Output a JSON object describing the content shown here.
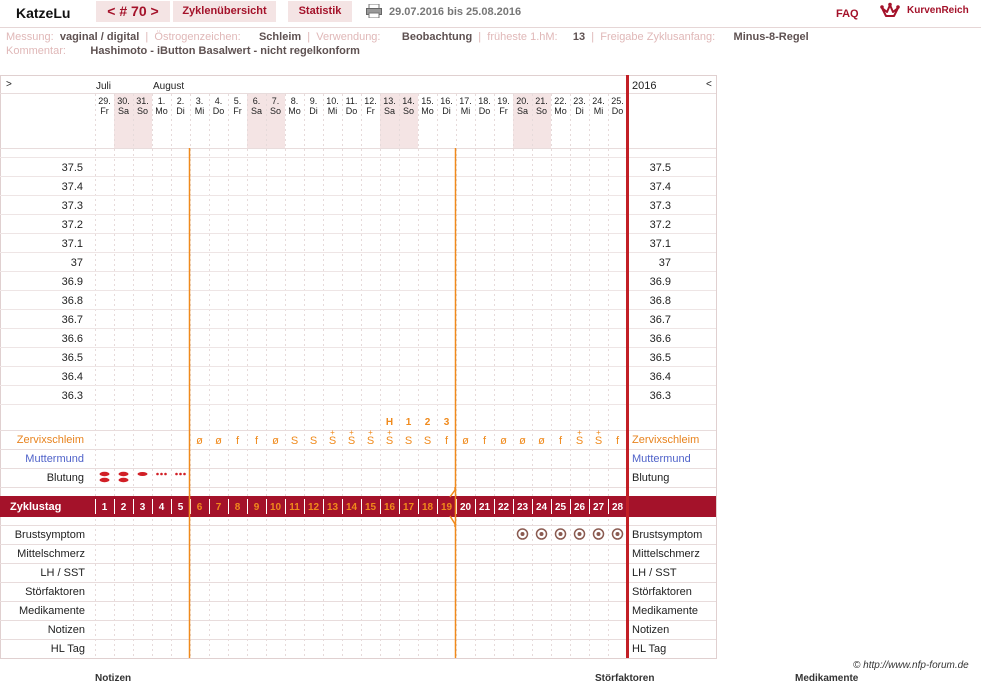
{
  "header": {
    "username": "KatzeLu",
    "cycle_nav": "< # 70 >",
    "tab_overview": "Zyklenübersicht",
    "tab_stats": "Statistik",
    "date_range": "29.07.2016 bis 25.08.2016",
    "faq": "FAQ",
    "brand": "KurvenReich"
  },
  "info": {
    "messung_label": "Messung:",
    "messung_value": "vaginal / digital",
    "oestrogen_label": "Östrogenzeichen:",
    "oestrogen_value": "Schleim",
    "verwendung_label": "Verwendung:",
    "verwendung_value": "Beobachtung",
    "fruehest_label": "früheste 1.hM:",
    "fruehest_value": "13",
    "freigabe_label": "Freigabe Zyklusanfang:",
    "freigabe_value": "Minus-8-Regel",
    "kommentar_label": "Kommentar:",
    "kommentar_value": "Hashimoto - iButton Basalwert - nicht regelkonform"
  },
  "chart": {
    "nav_left": ">",
    "nav_right": "<",
    "year": "2016",
    "months": [
      {
        "label": "Juli",
        "day_index": 0
      },
      {
        "label": "August",
        "day_index": 3
      }
    ],
    "days": [
      {
        "date": "29.",
        "wd": "Fr",
        "weekend": false
      },
      {
        "date": "30.",
        "wd": "Sa",
        "weekend": true
      },
      {
        "date": "31.",
        "wd": "So",
        "weekend": true
      },
      {
        "date": "1.",
        "wd": "Mo",
        "weekend": false
      },
      {
        "date": "2.",
        "wd": "Di",
        "weekend": false
      },
      {
        "date": "3.",
        "wd": "Mi",
        "weekend": false
      },
      {
        "date": "4.",
        "wd": "Do",
        "weekend": false
      },
      {
        "date": "5.",
        "wd": "Fr",
        "weekend": false
      },
      {
        "date": "6.",
        "wd": "Sa",
        "weekend": true
      },
      {
        "date": "7.",
        "wd": "So",
        "weekend": true
      },
      {
        "date": "8.",
        "wd": "Mo",
        "weekend": false
      },
      {
        "date": "9.",
        "wd": "Di",
        "weekend": false
      },
      {
        "date": "10.",
        "wd": "Mi",
        "weekend": false
      },
      {
        "date": "11.",
        "wd": "Do",
        "weekend": false
      },
      {
        "date": "12.",
        "wd": "Fr",
        "weekend": false
      },
      {
        "date": "13.",
        "wd": "Sa",
        "weekend": true
      },
      {
        "date": "14.",
        "wd": "So",
        "weekend": true
      },
      {
        "date": "15.",
        "wd": "Mo",
        "weekend": false
      },
      {
        "date": "16.",
        "wd": "Di",
        "weekend": false
      },
      {
        "date": "17.",
        "wd": "Mi",
        "weekend": false
      },
      {
        "date": "18.",
        "wd": "Do",
        "weekend": false
      },
      {
        "date": "19.",
        "wd": "Fr",
        "weekend": false
      },
      {
        "date": "20.",
        "wd": "Sa",
        "weekend": true
      },
      {
        "date": "21.",
        "wd": "So",
        "weekend": true
      },
      {
        "date": "22.",
        "wd": "Mo",
        "weekend": false
      },
      {
        "date": "23.",
        "wd": "Di",
        "weekend": false
      },
      {
        "date": "24.",
        "wd": "Mi",
        "weekend": false
      },
      {
        "date": "25.",
        "wd": "Do",
        "weekend": false
      }
    ],
    "temp_labels": [
      "37.5",
      "37.4",
      "37.3",
      "37.2",
      "37.1",
      "37",
      "36.9",
      "36.8",
      "36.7",
      "36.6",
      "36.5",
      "36.4",
      "36.3"
    ],
    "peak_markers": [
      {
        "day_index": 15,
        "label": "H"
      },
      {
        "day_index": 16,
        "label": "1"
      },
      {
        "day_index": 17,
        "label": "2"
      },
      {
        "day_index": 18,
        "label": "3"
      }
    ],
    "rows": {
      "zervix": "Zervixschleim",
      "muttermund": "Muttermund",
      "blutung": "Blutung",
      "zyklustag": "Zyklustag",
      "brust": "Brustsymptom",
      "mittel": "Mittelschmerz",
      "lh": "LH / SST",
      "stoer": "Störfaktoren",
      "medi": "Medikamente",
      "notizen": "Notizen",
      "hl": "HL Tag"
    },
    "zervix_values": [
      "",
      "",
      "",
      "",
      "",
      "ø",
      "ø",
      "f",
      "f",
      "ø",
      "S",
      "S",
      "S+",
      "S+",
      "S+",
      "S+",
      "S",
      "S",
      "f",
      "ø",
      "f",
      "ø",
      "ø",
      "ø",
      "f",
      "S+",
      "S+",
      "f"
    ],
    "blutung_values": [
      "heavy",
      "heavy",
      "medium",
      "spot",
      "spot",
      "",
      "",
      "",
      "",
      "",
      "",
      "",
      "",
      "",
      "",
      "",
      "",
      "",
      "",
      "",
      "",
      "",
      "",
      "",
      "",
      "",
      "",
      ""
    ],
    "zyklustag_values": [
      "1",
      "2",
      "3",
      "4",
      "5",
      "6",
      "7",
      "8",
      "9",
      "10",
      "11",
      "12",
      "13",
      "14",
      "15",
      "16",
      "17",
      "18",
      "19",
      "20",
      "21",
      "22",
      "23",
      "24",
      "25",
      "26",
      "27",
      "28"
    ],
    "brust_days": [
      22,
      23,
      24,
      25,
      26,
      27
    ],
    "vlines": [
      5,
      19
    ],
    "colors": {
      "accent": "#a4122a",
      "orange": "#f08a1c",
      "weekend": "#f4e4e4",
      "grid": "#e8dcdc",
      "muttermund": "#4f62c9",
      "zervix_label": "#e8831e"
    }
  },
  "footer": {
    "copyright": "© http://www.nfp-forum.de",
    "bottom_notizen": "Notizen",
    "bottom_stoer": "Störfaktoren",
    "bottom_medi": "Medikamente"
  }
}
